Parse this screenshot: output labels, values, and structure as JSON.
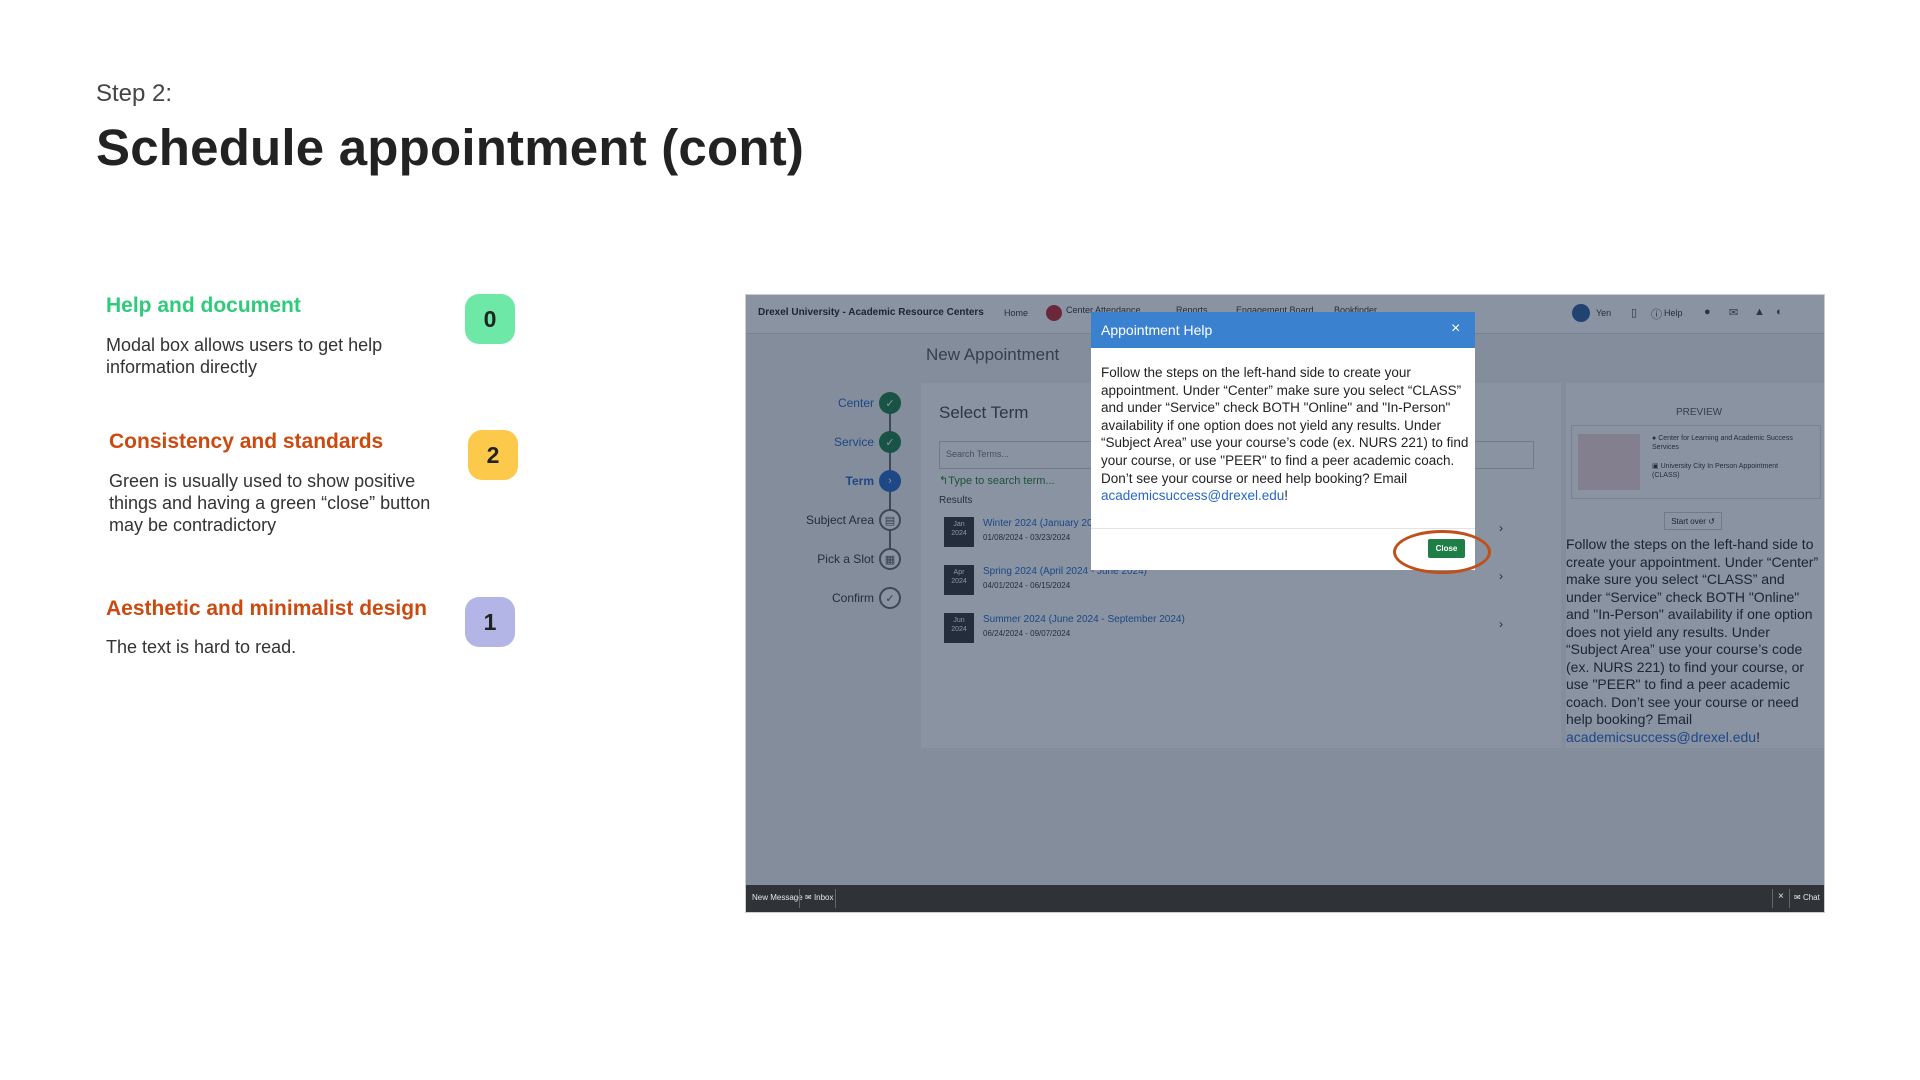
{
  "slide": {
    "step": "Step 2:",
    "title": "Schedule appointment (cont)"
  },
  "notes": [
    {
      "title": "Help and document",
      "body": "Modal box allows users to get help information directly",
      "badge": "0",
      "title_color": "#2ecc7a",
      "badge_color": "#6ee8a6"
    },
    {
      "title": "Consistency and standards",
      "body": "Green is usually used to show positive things and having a green “close” button may be contradictory",
      "badge": "2",
      "title_color": "#cc4a10",
      "badge_color": "#fdc94a"
    },
    {
      "title": "Aesthetic and minimalist design",
      "body": "The text is hard to read.",
      "badge": "1",
      "title_color": "#cc4a10",
      "badge_color": "#b2b5e6"
    }
  ],
  "app": {
    "brand": "Drexel University - Academic Resource Centers",
    "nav": [
      "Home",
      "Center Attendance",
      "Reports",
      "Engagement Board",
      "Bookfinder"
    ],
    "user": "Yen",
    "help_label": "Help",
    "page_title": "New Appointment",
    "steps": [
      {
        "label": "Center",
        "state": "done"
      },
      {
        "label": "Service",
        "state": "done"
      },
      {
        "label": "Term",
        "state": "current"
      },
      {
        "label": "Subject Area",
        "state": "todo",
        "icon": "book-icon"
      },
      {
        "label": "Pick a Slot",
        "state": "todo",
        "icon": "calendar-icon"
      },
      {
        "label": "Confirm",
        "state": "todo",
        "icon": "check-icon"
      }
    ],
    "select_term": {
      "title": "Select Term",
      "search_placeholder": "Search Terms...",
      "hint": "Type to search term...",
      "results_label": "Results",
      "terms": [
        {
          "mon": "Jan",
          "year": "2024",
          "name": "Winter 2024 (January 2024 - March 2024)",
          "range": "01/08/2024 - 03/23/2024"
        },
        {
          "mon": "Apr",
          "year": "2024",
          "name": "Spring 2024 (April 2024 - June 2024)",
          "range": "04/01/2024 - 06/15/2024"
        },
        {
          "mon": "Jun",
          "year": "2024",
          "name": "Summer 2024 (June 2024 - September 2024)",
          "range": "06/24/2024 - 09/07/2024"
        }
      ]
    },
    "preview": {
      "label": "PREVIEW",
      "center": "Center for Learning and Academic Success Services",
      "location": "University City In Person Appointment (CLASS)",
      "start_over": "Start over",
      "help_text": "Follow the steps on the left-hand side to create your appointment. Under “Center” make sure you select “CLASS” and under “Service” check BOTH \"Online\" and \"In-Person\" availability if one option does not yield any results. Under “Subject Area” use your course’s code (ex. NURS 221) to find your course, or use \"PEER\" to find a peer academic coach. Don’t see your course or need help booking? Email ",
      "email": "academicsuccess@drexel.edu",
      "suffix": "!"
    },
    "modal": {
      "title": "Appointment Help",
      "body": "Follow the steps on the left-hand side to create your appointment. Under “Center” make sure you select “CLASS” and under “Service” check BOTH \"Online\" and \"In-Person\" availability if one option does not yield any results. Under “Subject Area” use your course’s code (ex. NURS 221) to find your course, or use \"PEER\" to find a peer academic coach. Don’t see your course or need help booking? Email ",
      "email": "academicsuccess@drexel.edu",
      "suffix": "!",
      "close_label": "Close"
    },
    "footer": {
      "new_message": "New Message",
      "inbox": "Inbox",
      "chat": "Chat"
    }
  }
}
